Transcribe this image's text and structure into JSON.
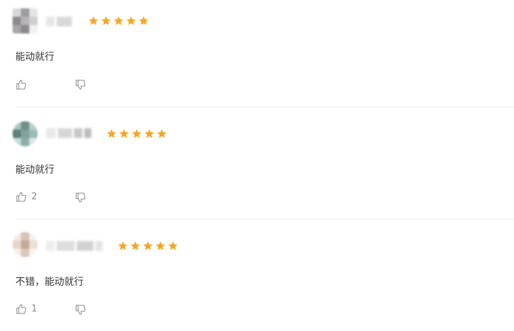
{
  "colors": {
    "star": "#F5A623",
    "divider": "#ECECEC",
    "text": "#333333",
    "action_icon": "#8A8A8A"
  },
  "reviews": [
    {
      "rating": 5,
      "comment": "能动就行",
      "like_count": "",
      "icons": {
        "like": "thumbs-up-icon",
        "dislike": "thumbs-down-icon"
      }
    },
    {
      "rating": 5,
      "comment": "能动就行",
      "like_count": "2",
      "icons": {
        "like": "thumbs-up-icon",
        "dislike": "thumbs-down-icon"
      }
    },
    {
      "rating": 5,
      "comment": "不错，能动就行",
      "like_count": "1",
      "icons": {
        "like": "thumbs-up-icon",
        "dislike": "thumbs-down-icon"
      }
    }
  ]
}
